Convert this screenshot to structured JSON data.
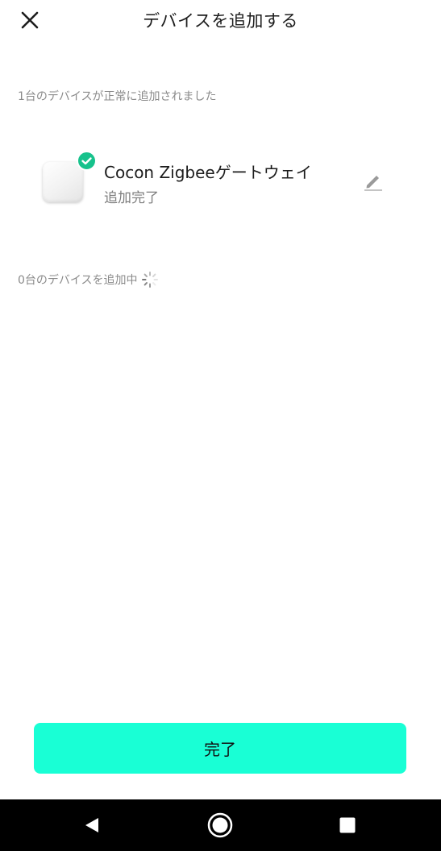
{
  "header": {
    "title": "デバイスを追加する",
    "close_icon": "close-icon"
  },
  "added_section": {
    "label": "1台のデバイスが正常に追加されました",
    "devices": [
      {
        "name": "Cocon Zigbeeゲートウェイ",
        "status": "追加完了",
        "badge_icon": "check-circle-icon",
        "edit_icon": "pencil-icon"
      }
    ]
  },
  "adding_section": {
    "label": "0台のデバイスを追加中",
    "spinner_icon": "loading-spinner-icon"
  },
  "footer": {
    "done_label": "完了"
  },
  "system_nav": {
    "icons": [
      "back-triangle-icon",
      "home-circle-icon",
      "recents-square-icon"
    ]
  },
  "colors": {
    "accent": "#19ffd5",
    "success": "#17c28c",
    "secondary_text": "#8a8a8a",
    "nav_background": "#000000"
  }
}
